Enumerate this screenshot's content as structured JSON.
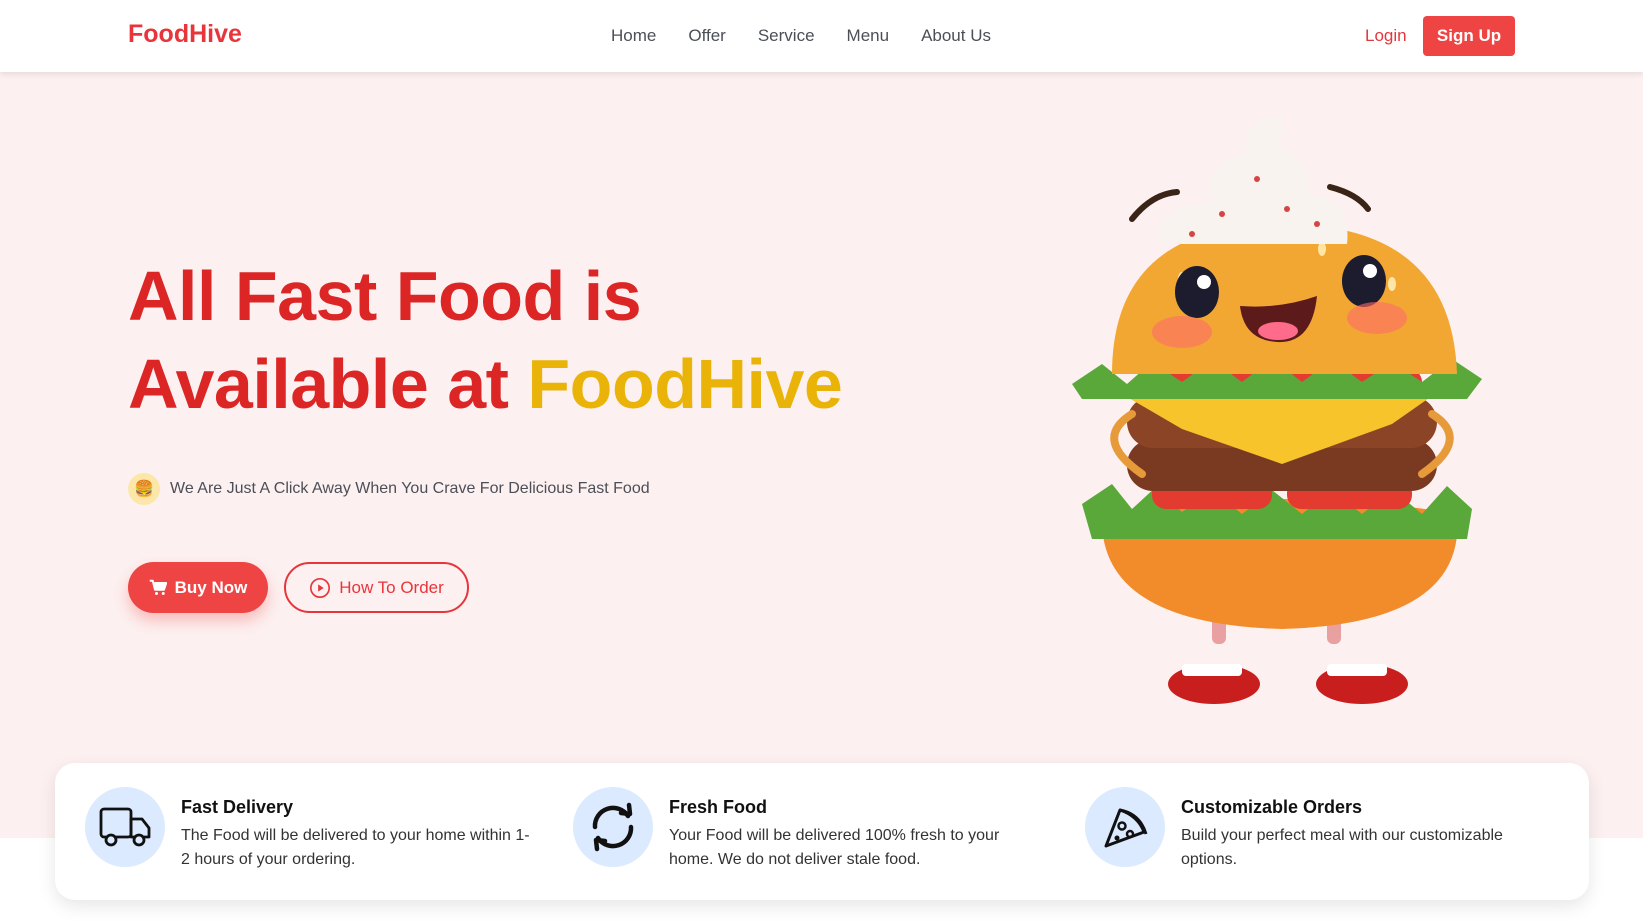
{
  "nav": {
    "logo": "FoodHive",
    "links": [
      "Home",
      "Offer",
      "Service",
      "Menu",
      "About Us"
    ],
    "login": "Login",
    "signup": "Sign Up"
  },
  "hero": {
    "headline_line1": "All Fast Food is",
    "headline_line2_prefix": "Available at ",
    "headline_brand": "FoodHive",
    "tagline": "We Are Just A Click Away When You Crave For Delicious Fast Food",
    "buy_button": "Buy Now",
    "how_button": "How To Order"
  },
  "features": [
    {
      "title": "Fast Delivery",
      "desc_line1": "The Food will be delivered to your home within 1-",
      "desc_line2": "2 hours of your ordering.",
      "icon": "truck-icon"
    },
    {
      "title": "Fresh Food",
      "desc_line1": "Your Food will be delivered 100% fresh to your",
      "desc_line2": "home. We do not deliver stale food.",
      "icon": "refresh-icon"
    },
    {
      "title": "Customizable Orders",
      "desc_line1": "Build your perfect meal with our customizable",
      "desc_line2": "options.",
      "icon": "pizza-slice-icon"
    }
  ],
  "colors": {
    "brand_red": "#e8353b",
    "brand_yellow": "#eab308",
    "hero_bg": "#fdf0f0",
    "feature_icon_bg": "#dbeafe"
  }
}
